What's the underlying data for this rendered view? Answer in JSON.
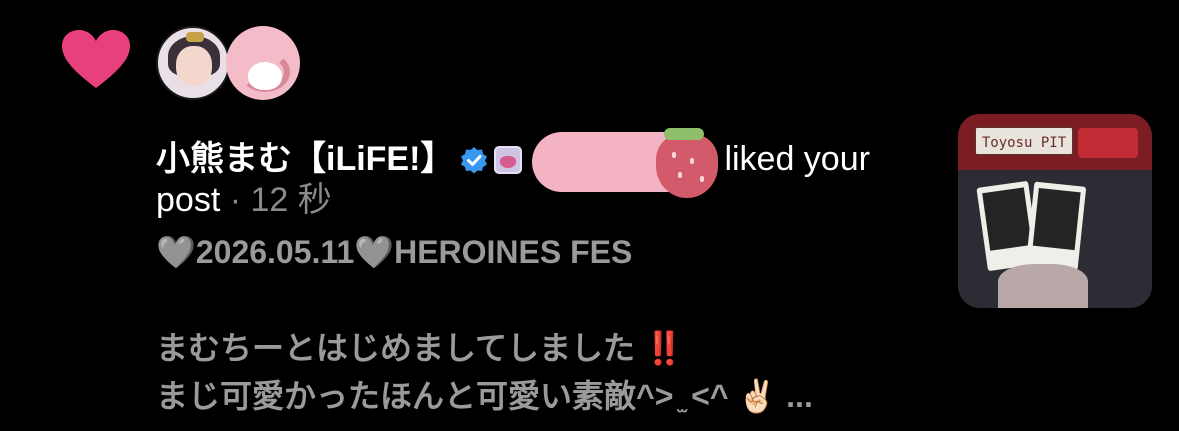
{
  "notification": {
    "type_icon": "heart-icon",
    "accent_color": "#e8407c",
    "avatars": [
      "user-avatar",
      "redacted-avatar"
    ],
    "username": "小熊まむ【iLiFE!】",
    "verified_icon": "verified-badge-icon",
    "badge_icon": "ilife-badge-icon",
    "action": "liked your",
    "post_word": "post",
    "separator": " · ",
    "time_ago": "12 秒",
    "post_excerpt": {
      "line1": "🩶2026.05.11🩶HEROINES FES",
      "line2": "",
      "line3_text": "まむちーとはじめましてしました ",
      "line3_emoji": "‼️",
      "line4": "まじ可愛かったほんと可愛い素敵^> ̫ <^ ✌🏻 ..."
    },
    "thumbnail": {
      "sign_text": "Toyosu PIT"
    }
  }
}
